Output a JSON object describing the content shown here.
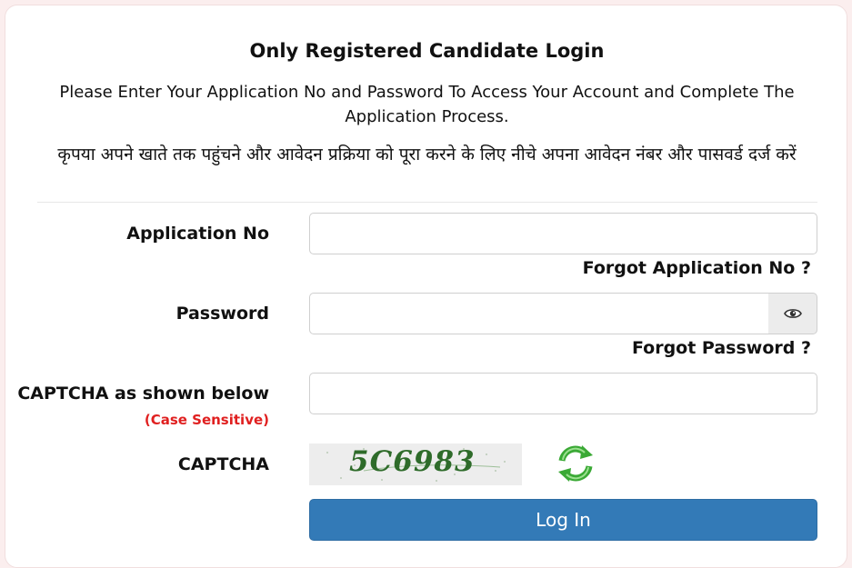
{
  "login": {
    "title": "Only Registered Candidate Login",
    "subtitle_en": "Please Enter Your Application No and Password To Access Your Account and Complete The Application Process.",
    "subtitle_hi": "कृपया अपने खाते तक पहुंचने और आवेदन प्रक्रिया को पूरा करने के लिए नीचे अपना आवेदन नंबर और पासवर्ड दर्ज करें"
  },
  "fields": {
    "application_no_label": "Application No",
    "application_no_value": "",
    "forgot_application_no": "Forgot Application No ?",
    "password_label": "Password",
    "password_value": "",
    "forgot_password": "Forgot Password ?",
    "captcha_input_label": "CAPTCHA as shown below",
    "captcha_case_note": "(Case Sensitive)",
    "captcha_input_value": "",
    "captcha_label": "CAPTCHA",
    "captcha_code": "5C6983"
  },
  "icons": {
    "password_toggle": "eye-icon",
    "captcha_refresh": "refresh-icon"
  },
  "colors": {
    "primary_button": "#337ab7",
    "case_note": "#e02020",
    "refresh_icon": "#3aa935"
  },
  "actions": {
    "login_label": "Log In"
  }
}
